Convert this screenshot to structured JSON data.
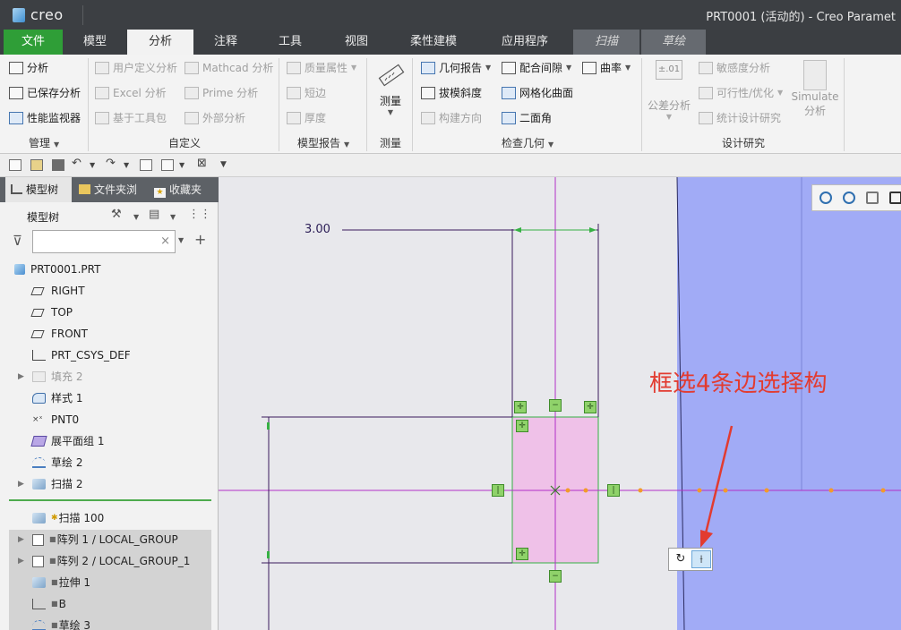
{
  "app": {
    "logo_text": "creo",
    "window_title": "PRT0001 (活动的) - Creo Paramet"
  },
  "tabs": [
    {
      "label": "文件"
    },
    {
      "label": "模型"
    },
    {
      "label": "分析"
    },
    {
      "label": "注释"
    },
    {
      "label": "工具"
    },
    {
      "label": "视图"
    },
    {
      "label": "柔性建模"
    },
    {
      "label": "应用程序"
    },
    {
      "label": "扫描"
    },
    {
      "label": "草绘"
    }
  ],
  "ribbon": {
    "manage": {
      "items": [
        "分析",
        "已保存分析",
        "性能监视器"
      ],
      "group_label": "管理"
    },
    "custom": {
      "items": [
        "用户定义分析",
        "Excel 分析",
        "基于工具包",
        "Mathcad 分析",
        "Prime 分析",
        "外部分析"
      ],
      "group_label": "自定义"
    },
    "model_report": {
      "items": [
        "质量属性",
        "短边",
        "厚度"
      ],
      "group_label": "模型报告"
    },
    "measure": {
      "button_label": "测量",
      "group_label": "测量"
    },
    "check_geometry": {
      "items": [
        "几何报告",
        "拔模斜度",
        "构建方向",
        "配合间隙",
        "网格化曲面",
        "二面角",
        "曲率"
      ],
      "group_label": "检查几何"
    },
    "design_study": {
      "tolerance_label": "公差分析",
      "tolerance_glyph": "±.01",
      "items": [
        "敏感度分析",
        "可行性/优化",
        "统计设计研究"
      ],
      "simulate_line1": "Simulate",
      "simulate_line2": "分析",
      "group_label": "设计研究"
    }
  },
  "panel": {
    "tabs": [
      "模型树",
      "文件夹浏",
      "收藏夹"
    ],
    "tree_header": "模型树",
    "filter_value": "",
    "tree_items": [
      {
        "label": "PRT0001.PRT",
        "icon": "part-icon"
      },
      {
        "label": "RIGHT",
        "icon": "datum-plane-icon"
      },
      {
        "label": "TOP",
        "icon": "datum-plane-icon"
      },
      {
        "label": "FRONT",
        "icon": "datum-plane-icon"
      },
      {
        "label": "PRT_CSYS_DEF",
        "icon": "csys-icon"
      },
      {
        "label": "填充 2",
        "icon": "fill-icon"
      },
      {
        "label": "样式 1",
        "icon": "style-icon"
      },
      {
        "label": "PNT0",
        "icon": "datum-point-icon"
      },
      {
        "label": "展平面组 1",
        "icon": "flatten-quilt-icon"
      },
      {
        "label": "草绘 2",
        "icon": "sketch-icon"
      },
      {
        "label": "扫描 2",
        "icon": "sweep-icon"
      },
      {
        "label": "扫描 100",
        "icon": "sweep-icon"
      },
      {
        "label": "阵列 1 / LOCAL_GROUP",
        "icon": "pattern-icon"
      },
      {
        "label": "阵列 2 / LOCAL_GROUP_1",
        "icon": "pattern-icon"
      },
      {
        "label": "拉伸 1",
        "icon": "extrude-icon"
      },
      {
        "label": "B",
        "icon": "datum-icon"
      },
      {
        "label": "草绘 3",
        "icon": "sketch-icon"
      }
    ]
  },
  "graphics": {
    "dimension_value": "3.00",
    "annotation_text": "框选4条边选择构",
    "colors": {
      "background": "#e8e8ec",
      "blue_region": "#a1abf6",
      "selection_fill": "#efc1e8",
      "sketch_line": "#3a1a5c",
      "centerline": "#b22fc7",
      "handle_green": "#8fd26a",
      "annotation_red": "#e23b30"
    }
  }
}
